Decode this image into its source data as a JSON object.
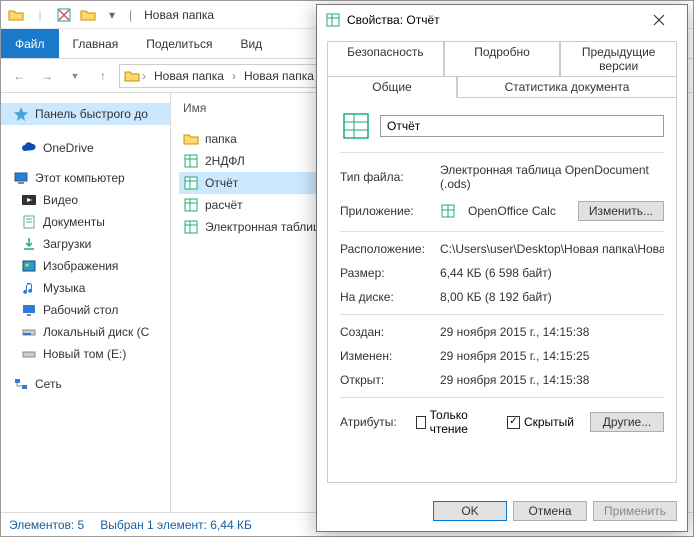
{
  "titlebar": {
    "title": "Новая папка"
  },
  "ribbon": {
    "file": "Файл",
    "home": "Главная",
    "share": "Поделиться",
    "view": "Вид"
  },
  "breadcrumb": {
    "c1": "Новая папка",
    "c2": "Новая папка"
  },
  "navpane": {
    "quick": "Панель быстрого до",
    "onedrive": "OneDrive",
    "thispc": "Этот компьютер",
    "videos": "Видео",
    "documents": "Документы",
    "downloads": "Загрузки",
    "pictures": "Изображения",
    "music": "Музыка",
    "desktop": "Рабочий стол",
    "localdisk": "Локальный диск (С",
    "newvol": "Новый том (E:)",
    "network": "Сеть"
  },
  "content": {
    "header_name": "Имя",
    "items": {
      "folder": "папка",
      "ndfl": "2НДФЛ",
      "report": "Отчёт",
      "calc": "расчёт",
      "etable": "Электронная таблиц"
    }
  },
  "statusbar": {
    "count": "Элементов: 5",
    "selection": "Выбран 1 элемент: 6,44 КБ"
  },
  "dialog": {
    "title": "Свойства: Отчёт",
    "tabs": {
      "security": "Безопасность",
      "details": "Подробно",
      "previous": "Предыдущие версии",
      "general": "Общие",
      "docstats": "Статистика документа"
    },
    "filename": "Отчёт",
    "type_label": "Тип файла:",
    "type_value": "Электронная таблица OpenDocument (.ods)",
    "app_label": "Приложение:",
    "app_value": "OpenOffice Calc",
    "change_btn": "Изменить...",
    "location_label": "Расположение:",
    "location_value": "C:\\Users\\user\\Desktop\\Новая папка\\Новая папка",
    "size_label": "Размер:",
    "size_value": "6,44 КБ (6 598 байт)",
    "ondisk_label": "На диске:",
    "ondisk_value": "8,00 КБ (8 192 байт)",
    "created_label": "Создан:",
    "created_value": "29 ноября 2015 г., 14:15:38",
    "modified_label": "Изменен:",
    "modified_value": "29 ноября 2015 г., 14:15:25",
    "accessed_label": "Открыт:",
    "accessed_value": "29 ноября 2015 г., 14:15:38",
    "attributes_label": "Атрибуты:",
    "readonly": "Только чтение",
    "hidden": "Скрытый",
    "other_btn": "Другие...",
    "ok": "OK",
    "cancel": "Отмена",
    "apply": "Применить"
  }
}
